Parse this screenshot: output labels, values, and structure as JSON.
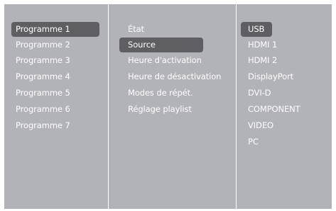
{
  "programmes": [
    "Programme 1",
    "Programme 2",
    "Programme 3",
    "Programme 4",
    "Programme 5",
    "Programme 6",
    "Programme 7"
  ],
  "settings": [
    "État",
    "Source",
    "Heure d'activation",
    "Heure de désactivation",
    "Modes de répét.",
    "Réglage playlist"
  ],
  "sources": [
    "USB",
    "HDMI 1",
    "HDMI 2",
    "DisplayPort",
    "DVI-D",
    "COMPONENT",
    "VIDEO",
    "PC"
  ],
  "selected": {
    "programme": "Programme 1",
    "setting": "Source",
    "source": "USB"
  },
  "colors": {
    "panel_bg": "#b2b2b9",
    "highlight": "#5f5f63",
    "text": "#ffffff",
    "divider": "#ffffff"
  }
}
